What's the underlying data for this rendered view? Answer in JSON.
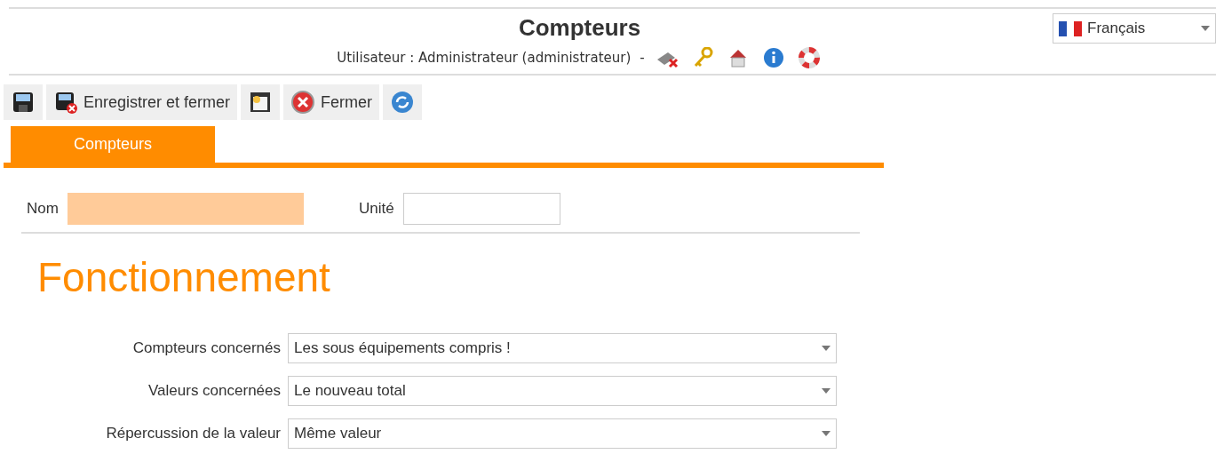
{
  "header": {
    "title": "Compteurs",
    "user_line": "Utilisateur : Administrateur (administrateur)",
    "separator": "-",
    "icons": [
      {
        "kind": "disconnect"
      },
      {
        "kind": "keys"
      },
      {
        "kind": "home"
      },
      {
        "kind": "info"
      },
      {
        "kind": "help"
      }
    ]
  },
  "language": {
    "value": "Français"
  },
  "toolbar": [
    {
      "kind": "save"
    },
    {
      "kind": "save-close",
      "label": "Enregistrer et fermer"
    },
    {
      "kind": "window"
    },
    {
      "kind": "close",
      "label": "Fermer"
    },
    {
      "kind": "refresh"
    }
  ],
  "tabs": [
    {
      "label": "Compteurs",
      "selected": true
    }
  ],
  "fields": [
    {
      "label": "Nom",
      "required": true
    },
    {
      "label": "Unité",
      "required": false
    }
  ],
  "section": {
    "title": "Fonctionnement",
    "rows": [
      {
        "label": "Compteurs concernés",
        "value": "Les sous équipements compris !"
      },
      {
        "label": "Valeurs concernées",
        "value": "Le nouveau total"
      },
      {
        "label": "Répercussion de la valeur",
        "value": "Même valeur"
      }
    ]
  }
}
